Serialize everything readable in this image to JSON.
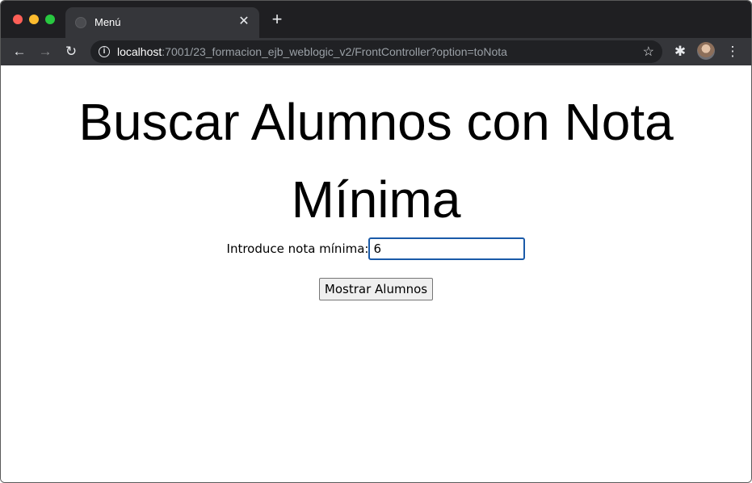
{
  "browser": {
    "tab_title": "Menú",
    "tab_close": "✕",
    "new_tab": "+",
    "url_host": "localhost",
    "url_rest": ":7001/23_formacion_ejb_weblogic_v2/FrontController?option=toNota",
    "icons": [
      "back-icon",
      "forward-icon",
      "reload-icon",
      "info-icon",
      "star-icon",
      "extensions-icon",
      "menu-icon"
    ]
  },
  "page": {
    "title": "Buscar Alumnos con Nota Mínima",
    "label": "Introduce nota mínima:",
    "input_value": "6",
    "button_label": "Mostrar Alumnos"
  },
  "colors": {
    "chrome_dark": "#1f1f22",
    "toolbar": "#35363a",
    "focus_border": "#1a5aa8"
  }
}
